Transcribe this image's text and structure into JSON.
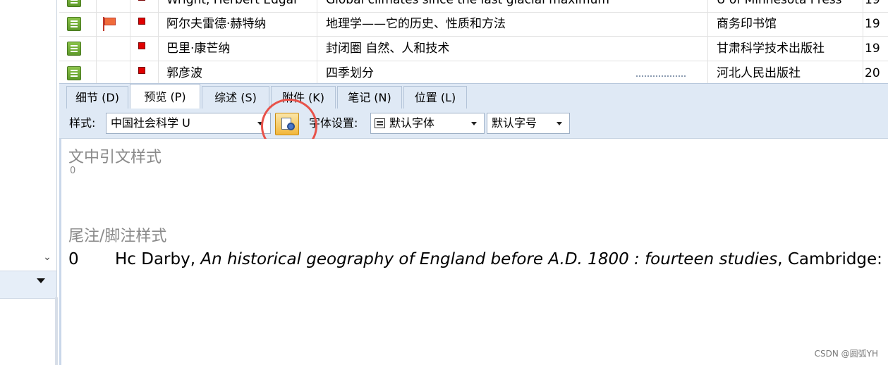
{
  "reference_list": {
    "rows": [
      {
        "author": "Wright, Herbert Edgar",
        "title": "Global climates since the last glacial maximum",
        "publisher": "U of Minnesota Press",
        "year": "19",
        "flag": false
      },
      {
        "author": "阿尔夫雷德·赫特纳",
        "title": "地理学——它的历史、性质和方法",
        "publisher": "商务印书馆",
        "year": "19",
        "flag": true
      },
      {
        "author": "巴里·康芒纳",
        "title": "封闭圈 自然、人和技术",
        "publisher": "甘肃科学技术出版社",
        "year": "19",
        "flag": false
      },
      {
        "author": "郭彦波",
        "title": "四季划分",
        "publisher": "河北人民出版社",
        "year": "20",
        "flag": false
      }
    ]
  },
  "tabs": [
    {
      "label": "细节 (D)",
      "active": false
    },
    {
      "label": "预览 (P)",
      "active": true
    },
    {
      "label": "综述 (S)",
      "active": false
    },
    {
      "label": "附件 (K)",
      "active": false
    },
    {
      "label": "笔记 (N)",
      "active": false
    },
    {
      "label": "位置 (L)",
      "active": false
    }
  ],
  "toolbar": {
    "style_label": "样式:",
    "style_value": "中国社会科学 U",
    "font_label": "字体设置:",
    "font_value": "默认字体",
    "size_value": "默认字号"
  },
  "preview": {
    "cite_heading": "文中引文样式",
    "cite_value": "0",
    "foot_heading": "尾注/脚注样式",
    "foot_num": "0",
    "foot_author": "Hc Darby, ",
    "foot_title": "An historical geography of England before A.D. 1800 : fourteen studies",
    "foot_rest": ", Cambridge: The"
  },
  "watermark": "CSDN @圆弧YH",
  "icons": {
    "book": "book-icon",
    "flag": "flag-icon",
    "type": "red-square-icon",
    "style_edit": "style-editor-icon",
    "font": "font-icon",
    "chevron": "chevron-down-icon"
  },
  "colors": {
    "highlight": "#e8524a",
    "tabbar_bg": "#dfe9f5",
    "button_accent": "#f2b73c"
  }
}
